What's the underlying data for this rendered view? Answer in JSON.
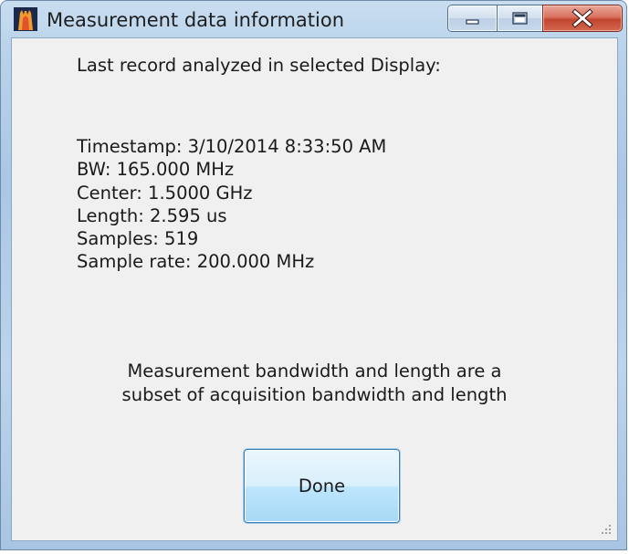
{
  "window": {
    "title": "Measurement data information",
    "icon": "spectrum-app-icon"
  },
  "caption_buttons": {
    "minimize_icon": "minimize-icon",
    "maximize_icon": "maximize-icon",
    "close_icon": "close-icon"
  },
  "content": {
    "heading": "Last record analyzed in selected Display:",
    "info_lines": [
      "Timestamp: 3/10/2014 8:33:50 AM",
      "BW: 165.000 MHz",
      "Center: 1.5000 GHz",
      "Length: 2.595 us",
      "Samples: 519",
      "Sample rate: 200.000 MHz"
    ],
    "note_line1": "Measurement bandwidth and length are a",
    "note_line2": "subset of acquisition bandwidth and length"
  },
  "buttons": {
    "done_label": "Done"
  },
  "colors": {
    "close_button": "#c24530",
    "frame": "#b8d2ea",
    "client_bg": "#f0f0f0",
    "done_button": "#bee6fd"
  }
}
